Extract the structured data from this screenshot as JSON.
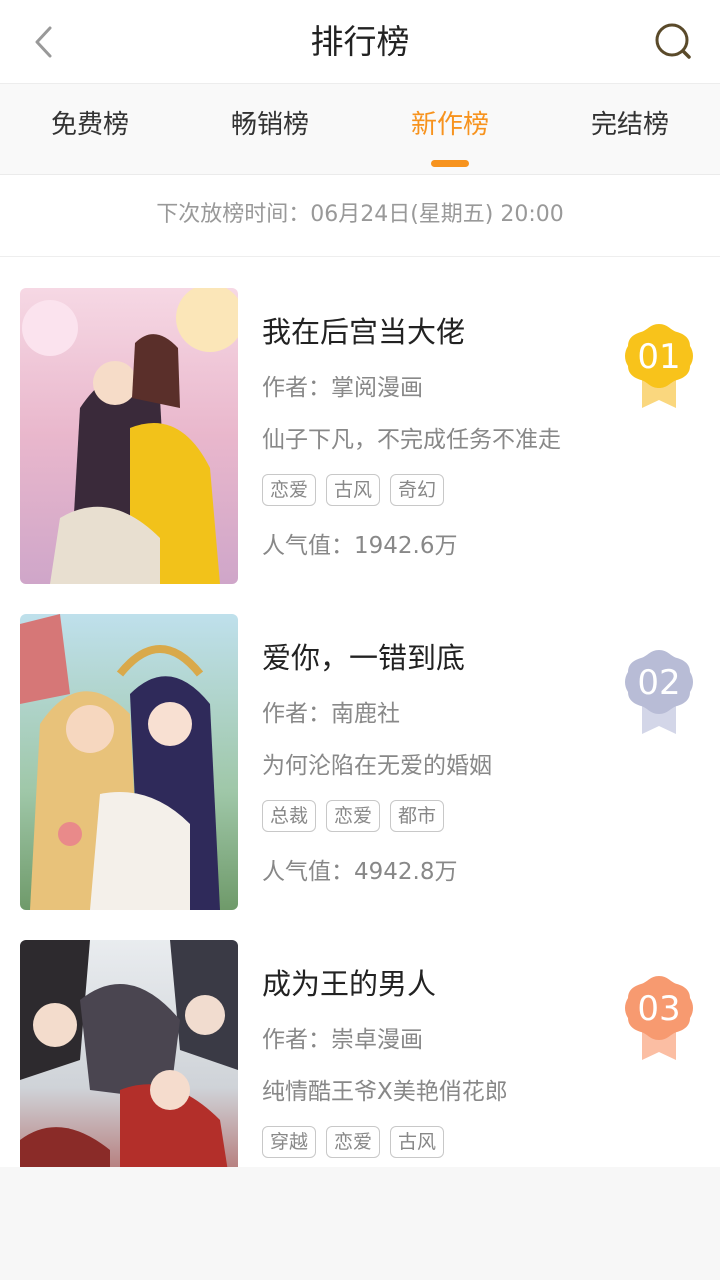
{
  "header": {
    "title": "排行榜"
  },
  "tabs": [
    {
      "label": "免费榜",
      "active": false
    },
    {
      "label": "畅销榜",
      "active": false
    },
    {
      "label": "新作榜",
      "active": true
    },
    {
      "label": "完结榜",
      "active": false
    }
  ],
  "notice": "下次放榜时间：06月24日(星期五) 20:00",
  "items": [
    {
      "title": "我在后宫当大佬",
      "author": "作者：掌阅漫画",
      "desc": "仙子下凡，不完成任务不准走",
      "tags": [
        "恋爱",
        "古风",
        "奇幻"
      ],
      "popularity": "人气值：1942.6万",
      "rank": "01",
      "badge_color": "#f8c31b"
    },
    {
      "title": "爱你，一错到底",
      "author": "作者：南鹿社",
      "desc": "为何沦陷在无爱的婚姻",
      "tags": [
        "总裁",
        "恋爱",
        "都市"
      ],
      "popularity": "人气值：4942.8万",
      "rank": "02",
      "badge_color": "#b8bcd6"
    },
    {
      "title": "成为王的男人",
      "author": "作者：崇卓漫画",
      "desc": "纯情酷王爷X美艳俏花郎",
      "tags": [
        "穿越",
        "恋爱",
        "古风"
      ],
      "popularity": "",
      "rank": "03",
      "badge_color": "#f79a70"
    }
  ],
  "icons": {
    "back": "chevron-left-icon",
    "search": "search-icon"
  },
  "colors": {
    "accent": "#f7931e"
  }
}
